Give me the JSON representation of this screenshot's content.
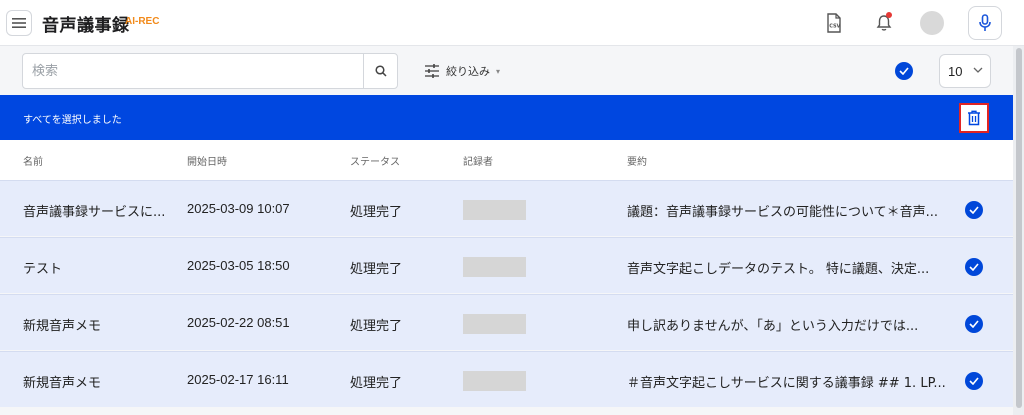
{
  "header": {
    "title": "音声議事録",
    "badge": "AI-REC",
    "icons": [
      "menu-icon",
      "csv-file-icon",
      "bell-icon",
      "avatar",
      "microphone-icon"
    ],
    "notification_dot_color": "#e53935"
  },
  "toolbar": {
    "search_placeholder": "検索",
    "search_value": "",
    "filter_label": "絞り込み",
    "page_size": "10"
  },
  "banner": {
    "text": "すべてを選択しました",
    "color": "#0047e0"
  },
  "table": {
    "columns": [
      "名前",
      "開始日時",
      "ステータス",
      "記録者",
      "要約"
    ],
    "rows": [
      {
        "name": "音声議事録サービスに...",
        "date": "2025-03-09 10:07",
        "status": "処理完了",
        "recorder": "",
        "summary": "議題：音声議事録サービスの可能性について＊音声...",
        "selected": true
      },
      {
        "name": "テスト",
        "date": "2025-03-05 18:50",
        "status": "処理完了",
        "recorder": "",
        "summary": "音声文字起こしデータのテスト。 特に議題、決定...",
        "selected": true
      },
      {
        "name": "新規音声メモ",
        "date": "2025-02-22 08:51",
        "status": "処理完了",
        "recorder": "",
        "summary": "申し訳ありませんが、「あ」という入力だけでは...",
        "selected": true
      },
      {
        "name": "新規音声メモ",
        "date": "2025-02-17 16:11",
        "status": "処理完了",
        "recorder": "",
        "summary": "＃音声文字起こしサービスに関する議事録 ## 1. LP...",
        "selected": true
      }
    ]
  },
  "colors": {
    "accent": "#0047d9",
    "row_selected_bg": "#e6ecfb",
    "delete_outline": "#e02424"
  }
}
